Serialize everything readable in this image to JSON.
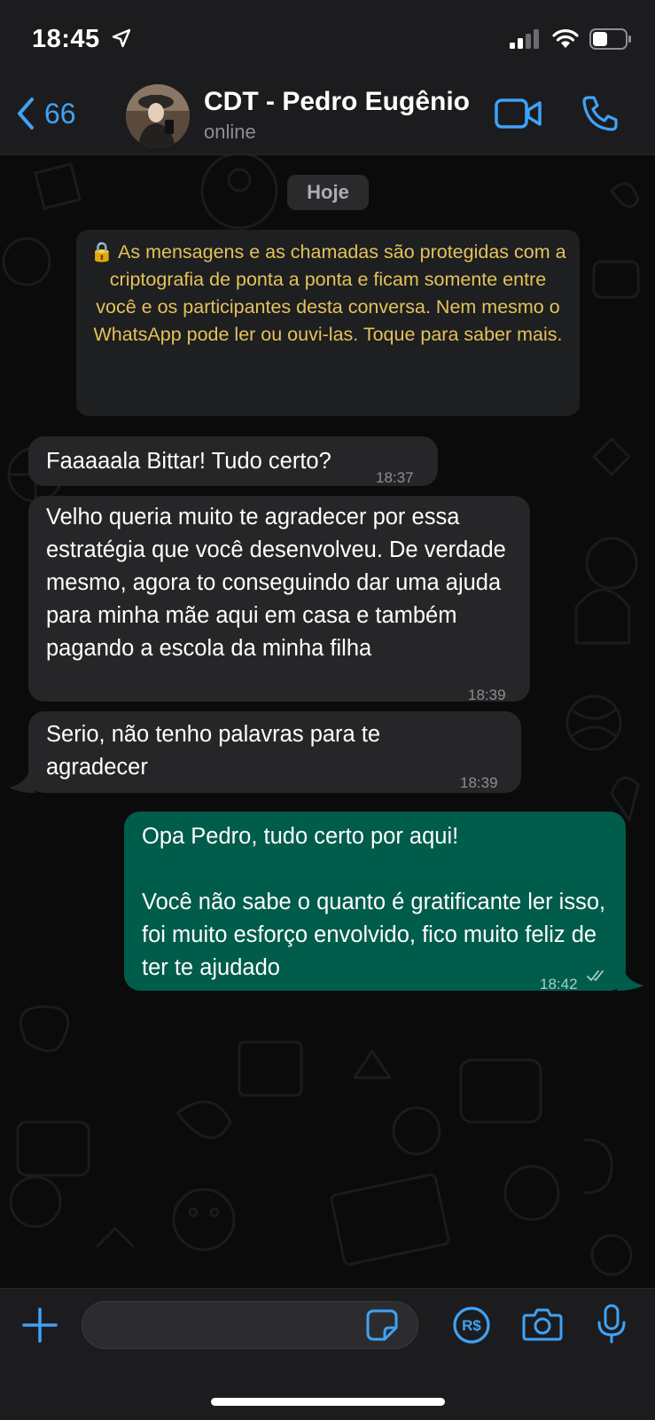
{
  "status_bar": {
    "time": "18:45"
  },
  "header": {
    "back_count": "66",
    "contact_name": "CDT - Pedro Eugênio",
    "contact_status": "online"
  },
  "chat": {
    "day_label": "Hoje",
    "encryption_notice": "🔒 As mensagens e as chamadas são protegidas com a criptografia de ponta a ponta e ficam somente entre você e os participantes desta conversa. Nem mesmo o WhatsApp pode ler ou ouvi-las. Toque para saber mais.",
    "messages": [
      {
        "direction": "incoming",
        "text": "Faaaaala Bittar! Tudo certo?",
        "time": "18:37"
      },
      {
        "direction": "incoming",
        "text": "Velho queria muito te agradecer por essa estratégia que você desenvolveu. De verdade mesmo, agora to conseguindo dar uma ajuda para minha mãe aqui em casa e também pagando a escola da minha filha",
        "time": "18:39"
      },
      {
        "direction": "incoming",
        "text": "Serio, não tenho palavras para te agradecer",
        "time": "18:39"
      },
      {
        "direction": "outgoing",
        "text_line_1": "Opa Pedro, tudo certo por aqui!",
        "text_line_2": "Você não sabe o quanto é gratificante ler isso, foi muito esforço envolvido, fico muito feliz de ter te ajudado",
        "time": "18:42",
        "status": "read"
      }
    ]
  },
  "composer": {
    "input_value": "",
    "icons": [
      "plus-icon",
      "sticker-icon",
      "payment-icon",
      "camera-icon",
      "microphone-icon"
    ]
  },
  "colors": {
    "accent": "#3fa2f7",
    "incoming_bubble": "#262628",
    "outgoing_bubble": "#005c4b",
    "notice_text": "#e6c15a"
  }
}
